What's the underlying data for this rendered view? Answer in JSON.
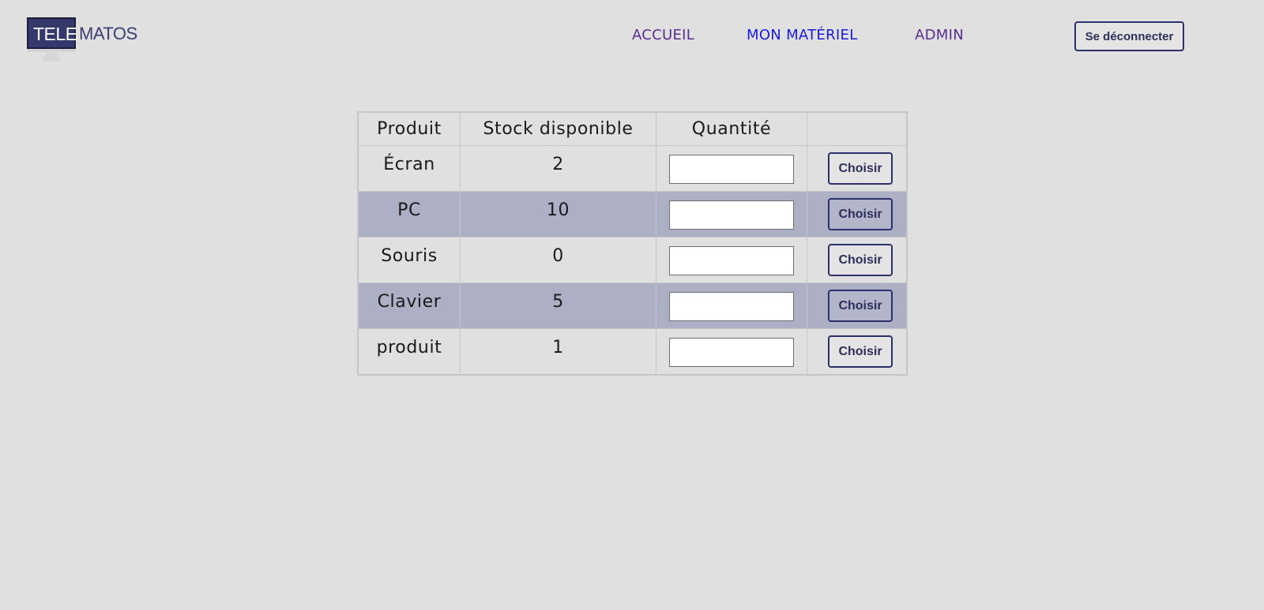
{
  "brand": {
    "logo_part1": "TELE",
    "logo_part2": "MATOS",
    "primary_color": "#34386a"
  },
  "nav": {
    "home": "ACCUEIL",
    "my_equipment": "MON MATÉRIEL",
    "admin": "ADMIN"
  },
  "auth": {
    "logout_label": "Se déconnecter"
  },
  "table": {
    "headers": {
      "product": "Produit",
      "stock": "Stock disponible",
      "quantity": "Quantité",
      "action": ""
    },
    "rows": [
      {
        "product": "Écran",
        "stock": "2",
        "quantity": "",
        "action_label": "Choisir"
      },
      {
        "product": "PC",
        "stock": "10",
        "quantity": "",
        "action_label": "Choisir"
      },
      {
        "product": "Souris",
        "stock": "0",
        "quantity": "",
        "action_label": "Choisir"
      },
      {
        "product": "Clavier",
        "stock": "5",
        "quantity": "",
        "action_label": "Choisir"
      },
      {
        "product": "produit",
        "stock": "1",
        "quantity": "",
        "action_label": "Choisir"
      }
    ],
    "stripe_color": "#adafc4"
  }
}
